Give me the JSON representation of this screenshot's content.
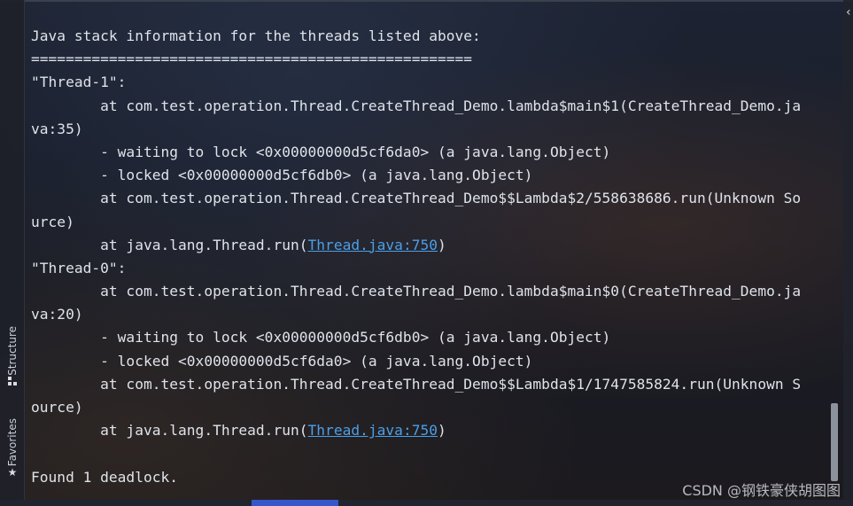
{
  "toolstrip": {
    "structure_label": "Structure",
    "favorites_label": "Favorites",
    "structure_icon": "structure-icon",
    "favorites_icon": "star-icon"
  },
  "console": {
    "lines": [
      "Java stack information for the threads listed above:",
      "===================================================",
      "\"Thread-1\":",
      "        at com.test.operation.Thread.CreateThread_Demo.lambda$main$1(CreateThread_Demo.ja",
      "va:35)",
      "        - waiting to lock <0x00000000d5cf6da0> (a java.lang.Object)",
      "        - locked <0x00000000d5cf6db0> (a java.lang.Object)",
      "        at com.test.operation.Thread.CreateThread_Demo$$Lambda$2/558638686.run(Unknown So",
      "urce)",
      "        at java.lang.Thread.run(",
      "\"Thread-0\":",
      "        at com.test.operation.Thread.CreateThread_Demo.lambda$main$0(CreateThread_Demo.ja",
      "va:20)",
      "        - waiting to lock <0x00000000d5cf6db0> (a java.lang.Object)",
      "        - locked <0x00000000d5cf6da0> (a java.lang.Object)",
      "        at com.test.operation.Thread.CreateThread_Demo$$Lambda$1/1747585824.run(Unknown S",
      "ource)",
      "        at java.lang.Thread.run(",
      "",
      "Found 1 deadlock."
    ],
    "link_text": "Thread.java:750",
    "link_suffix": ")"
  },
  "watermark": "CSDN @钢铁豪侠胡图图",
  "colors": {
    "text": "#dfe3ea",
    "link": "#4a9fe8",
    "accent": "#3656c9"
  }
}
